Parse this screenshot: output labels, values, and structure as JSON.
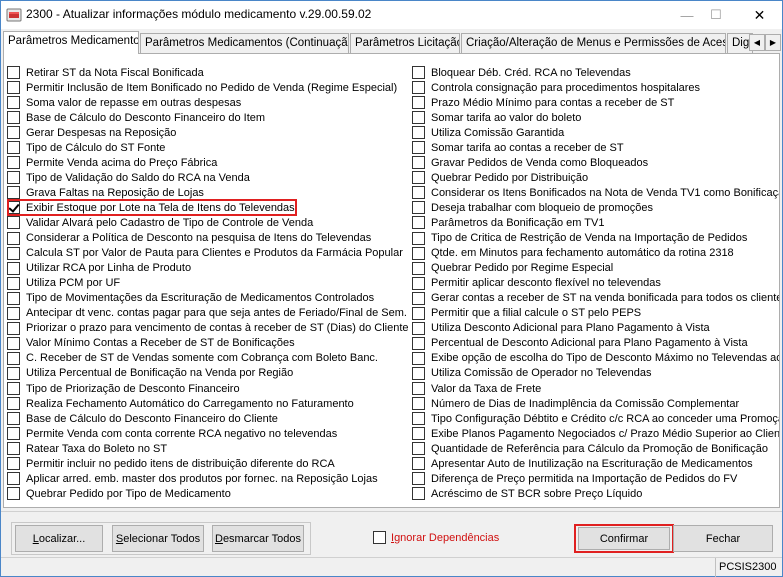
{
  "window": {
    "title": "2300 - Atualizar informações módulo medicamento v.29.00.59.02",
    "min_glyph": "—",
    "max_glyph": "☐",
    "close_glyph": "✕"
  },
  "tabs": [
    {
      "label": "Parâmetros Medicamentos",
      "active": true
    },
    {
      "label": "Parâmetros Medicamentos (Continuação)",
      "active": false
    },
    {
      "label": "Parâmetros Licitação",
      "active": false
    },
    {
      "label": "Criação/Alteração de Menus e Permissões de Acesso",
      "active": false
    },
    {
      "label": "Digi",
      "active": false
    }
  ],
  "tab_scroll": {
    "left": "◀",
    "right": "▶"
  },
  "left_options": [
    {
      "label": "Retirar ST da Nota Fiscal Bonificada",
      "checked": false
    },
    {
      "label": "Permitir Inclusão de Item Bonificado no Pedido de Venda (Regime Especial)",
      "checked": false
    },
    {
      "label": "Soma valor de repasse em outras despesas",
      "checked": false
    },
    {
      "label": "Base de Cálculo do Desconto Financeiro do Item",
      "checked": false
    },
    {
      "label": "Gerar Despesas na Reposição",
      "checked": false
    },
    {
      "label": "Tipo de Cálculo do ST Fonte",
      "checked": false
    },
    {
      "label": "Permite Venda acima do Preço Fábrica",
      "checked": false
    },
    {
      "label": "Tipo de Validação do Saldo do RCA na Venda",
      "checked": false
    },
    {
      "label": "Grava Faltas na Reposição de Lojas",
      "checked": false
    },
    {
      "label": "Exibir Estoque por Lote na Tela de Itens do Televendas",
      "checked": true
    },
    {
      "label": "Validar Alvará pelo Cadastro de Tipo de Controle de Venda",
      "checked": false
    },
    {
      "label": "Considerar a Política de Desconto na pesquisa de Itens do Televendas",
      "checked": false
    },
    {
      "label": "Calcula ST por Valor de Pauta para Clientes e Produtos da Farmácia Popular",
      "checked": false
    },
    {
      "label": "Utilizar RCA por Linha de Produto",
      "checked": false
    },
    {
      "label": "Utiliza PCM por UF",
      "checked": false
    },
    {
      "label": "Tipo de Movimentações da Escrituração de Medicamentos Controlados",
      "checked": false
    },
    {
      "label": "Antecipar dt venc. contas pagar para que seja antes de Feriado/Final de Sem.",
      "checked": false
    },
    {
      "label": "Priorizar o prazo para vencimento de contas à receber de ST (Dias) do Cliente",
      "checked": false
    },
    {
      "label": "Valor Mínimo Contas a Receber de ST de Bonificações",
      "checked": false
    },
    {
      "label": "C. Receber de ST de Vendas somente com Cobrança com  Boleto Banc.",
      "checked": false
    },
    {
      "label": "Utiliza Percentual de Bonificação na Venda por Região",
      "checked": false
    },
    {
      "label": "Tipo de Priorização de Desconto Financeiro",
      "checked": false
    },
    {
      "label": "Realiza Fechamento Automático do Carregamento no Faturamento",
      "checked": false
    },
    {
      "label": "Base de Cálculo do Desconto Financeiro do Cliente",
      "checked": false
    },
    {
      "label": "Permite Venda com conta corrente RCA negativo no televendas",
      "checked": false
    },
    {
      "label": "Ratear Taxa do Boleto no ST",
      "checked": false
    },
    {
      "label": "Permitir incluir no pedido itens de distribuição diferente do RCA",
      "checked": false
    },
    {
      "label": "Aplicar arred. emb. master dos produtos por fornec. na Reposição Lojas",
      "checked": false
    },
    {
      "label": "Quebrar Pedido por Tipo de Medicamento",
      "checked": false
    }
  ],
  "right_options": [
    {
      "label": "Bloquear Déb. Créd.  RCA no Televendas",
      "checked": false
    },
    {
      "label": "Controla consignação para procedimentos hospitalares",
      "checked": false
    },
    {
      "label": "Prazo Médio Mínimo para contas a receber de ST",
      "checked": false
    },
    {
      "label": "Somar tarifa ao valor do boleto",
      "checked": false
    },
    {
      "label": "Utiliza Comissão Garantida",
      "checked": false
    },
    {
      "label": "Somar tarifa ao contas a receber de ST",
      "checked": false
    },
    {
      "label": "Gravar Pedidos de Venda como Bloqueados",
      "checked": false
    },
    {
      "label": "Quebrar Pedido por Distribuição",
      "checked": false
    },
    {
      "label": "Considerar os Itens Bonificados na Nota de Venda TV1 como Bonificação",
      "checked": false
    },
    {
      "label": "Deseja trabalhar com bloqueio de promoções",
      "checked": false
    },
    {
      "label": "Parâmetros da Bonificação em TV1",
      "checked": false
    },
    {
      "label": "Tipo de Critica de Restrição de Venda na Importação de Pedidos",
      "checked": false
    },
    {
      "label": "Qtde. em Minutos para fechamento automático da rotina 2318",
      "checked": false
    },
    {
      "label": "Quebrar Pedido por Regime Especial",
      "checked": false
    },
    {
      "label": "Permitir aplicar desconto flexível no televendas",
      "checked": false
    },
    {
      "label": "Gerar contas a receber de ST na venda bonificada para todos os clientes",
      "checked": false
    },
    {
      "label": "Permitir que a filial calcule o ST pelo PEPS",
      "checked": false
    },
    {
      "label": "Utiliza Desconto Adicional para Plano Pagamento à Vista",
      "checked": false
    },
    {
      "label": "Percentual de Desconto Adicional para Plano Pagamento à Vista",
      "checked": false
    },
    {
      "label": "Exibe opção de escolha do Tipo de Desconto Máximo no Televendas ao i",
      "checked": false
    },
    {
      "label": "Utiliza Comissão de Operador no Televendas",
      "checked": false
    },
    {
      "label": "Valor da Taxa de Frete",
      "checked": false
    },
    {
      "label": "Número de Dias de Inadimplência da Comissão Complementar",
      "checked": false
    },
    {
      "label": "Tipo Configuração Débtito e Crédito c/c RCA ao conceder uma Promoção",
      "checked": false
    },
    {
      "label": "Exibe Planos Pagamento Negociados c/ Prazo Médio Superior ao Cliente",
      "checked": false
    },
    {
      "label": "Quantidade de Referência para Cálculo da Promoção de Bonificação",
      "checked": false
    },
    {
      "label": "Apresentar Auto de Inutilização na Escrituração de Medicamentos",
      "checked": false
    },
    {
      "label": "Diferença de Preço permitida na Importação de Pedidos do  FV",
      "checked": false
    },
    {
      "label": "Acréscimo de ST BCR sobre Preço Líquido",
      "checked": false
    }
  ],
  "buttons": {
    "localizar_u": "L",
    "localizar_rest": "ocalizar...",
    "selecionar_u": "S",
    "selecionar_rest": "elecionar Todos",
    "desmarcar_u": "D",
    "desmarcar_rest": "esmarcar Todos",
    "confirmar": "Confirmar",
    "fechar": "Fechar"
  },
  "ignore_dependencies": {
    "label_u": "I",
    "label_rest": "gnorar Dependências",
    "checked": false
  },
  "status": {
    "code": "PCSIS2300"
  }
}
